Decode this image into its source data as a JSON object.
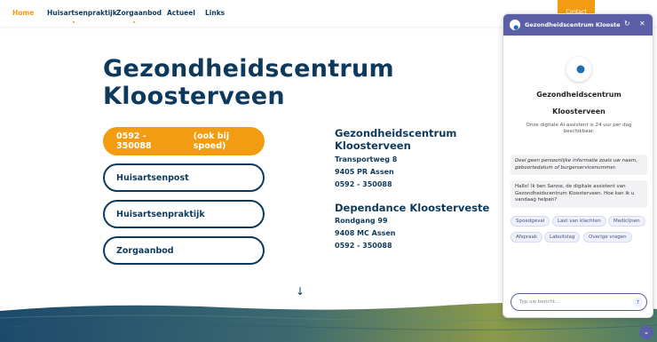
{
  "nav": {
    "items": [
      {
        "label": "Home",
        "active": true
      },
      {
        "label": "Huisartsenpraktijk",
        "active": false
      },
      {
        "label": "Zorgaanbod",
        "active": false
      },
      {
        "label": "Actueel",
        "active": false
      },
      {
        "label": "Links",
        "active": false
      }
    ],
    "contact": "Contact"
  },
  "hero": {
    "title_line1": "Gezondheidscentrum",
    "title_line2": "Kloosterveen"
  },
  "buttons": {
    "phone": "0592 - 350088",
    "phone_note": "(ook bij spoed)",
    "huisartsenpost": "Huisartsenpost",
    "huisartsenpraktijk": "Huisartsenpraktijk",
    "zorgaanbod": "Zorgaanbod"
  },
  "address1": {
    "name_line1": "Gezondheidscentrum",
    "name_line2": "Kloosterveen",
    "street": "Transportweg 8",
    "city": "9405 PR Assen",
    "phone": "0592 - 350088"
  },
  "address2": {
    "name": "Dependance Kloosterveste",
    "street": "Rondgang 99",
    "city": "9408 MC Assen",
    "phone": "0592 - 350088"
  },
  "chat": {
    "header_title": "Gezondheidscentrum Klooste...",
    "name_line1": "Gezondheidscentrum",
    "name_line2": "Kloosterveen",
    "subtitle": "Onze digitale AI-assistent is 24 uur per dag beschikbaar.",
    "notice": "Deel geen persoonlijke informatie zoals uw naam, geboortedatum of burgerservicenummer.",
    "greeting": "Hallo! Ik ben Sanne, de digitale assistent van Gezondheidscentrum Kloosterveen. Hoe kan ik u vandaag helpen?",
    "chips": [
      "Spoedgeval",
      "Last van klachten",
      "Medicijnen",
      "Afspraak",
      "Labuitslag",
      "Overige vragen"
    ],
    "input_placeholder": "Typ uw bericht..."
  },
  "colors": {
    "primary": "#0d3a5c",
    "accent": "#f39c12",
    "chat": "#5b5fa6"
  }
}
